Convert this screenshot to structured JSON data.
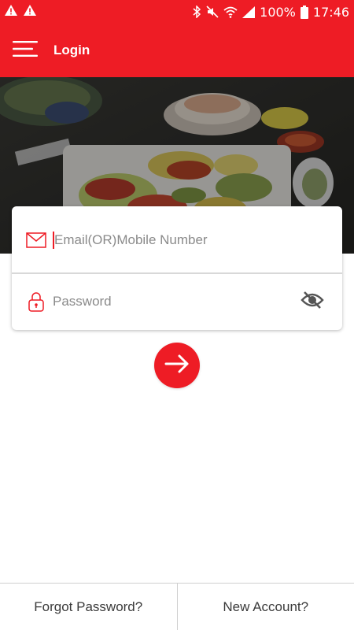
{
  "status_bar": {
    "battery": "100%",
    "time": "17:46",
    "left_icons": [
      "warning-icon",
      "warning-icon"
    ],
    "right_icons": [
      "bluetooth-icon",
      "mute-icon",
      "wifi-icon",
      "signal-icon",
      "battery-icon"
    ]
  },
  "app_bar": {
    "title": "Login",
    "menu_icon": "hamburger-menu-icon"
  },
  "login": {
    "email_placeholder": "Email(OR)Mobile Number",
    "email_value": "",
    "password_placeholder": "Password",
    "password_value": "",
    "email_icon": "envelope-icon",
    "password_icon": "lock-icon",
    "visibility_icon": "eye-off-icon",
    "submit_icon": "arrow-right-icon"
  },
  "footer": {
    "forgot": "Forgot Password?",
    "new_account": "New Account?"
  },
  "colors": {
    "accent": "#ee1c25",
    "text": "#3a3a3a",
    "placeholder": "#8a8a8a"
  }
}
